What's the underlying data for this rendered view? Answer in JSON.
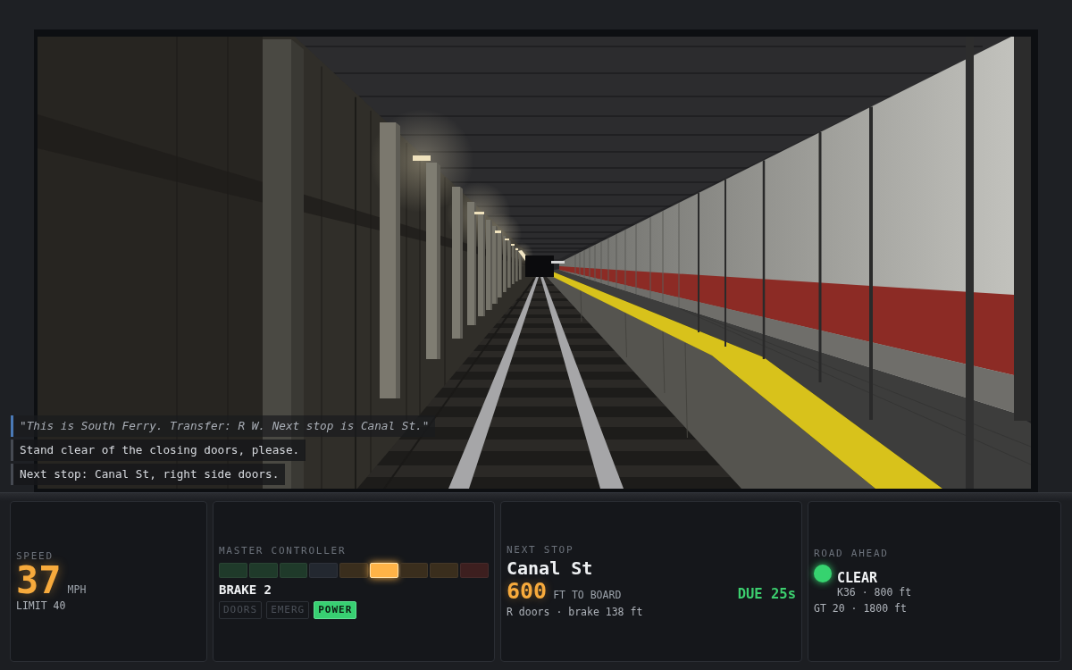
{
  "viewport": {
    "captions": [
      {
        "kind": "announcement",
        "text": "\"This is South Ferry. Transfer: R W. Next stop is Canal St.\""
      },
      {
        "kind": "message",
        "text": "Stand clear of the closing doors, please."
      },
      {
        "kind": "message",
        "text": "Next stop: Canal St, right side doors."
      }
    ]
  },
  "hud": {
    "speed": {
      "label": "SPEED",
      "value": "37",
      "unit": "MPH",
      "limit": "LIMIT 40"
    },
    "master_controller": {
      "label": "MASTER CONTROLLER",
      "notches": [
        {
          "kind": "power",
          "selected": false
        },
        {
          "kind": "power",
          "selected": false
        },
        {
          "kind": "power",
          "selected": false
        },
        {
          "kind": "coast",
          "selected": false
        },
        {
          "kind": "brake",
          "selected": false
        },
        {
          "kind": "brake",
          "selected": true
        },
        {
          "kind": "brake",
          "selected": false
        },
        {
          "kind": "brake",
          "selected": false
        },
        {
          "kind": "emergency",
          "selected": false
        }
      ],
      "position": "BRAKE 2",
      "indicators": [
        {
          "label": "DOORS",
          "on": false
        },
        {
          "label": "EMERG",
          "on": false
        },
        {
          "label": "POWER",
          "on": true
        }
      ]
    },
    "next_stop": {
      "label": "NEXT STOP",
      "station": "Canal St",
      "distance": "600",
      "distance_unit": "FT TO BOARD",
      "due": "DUE 25s",
      "detail": "R doors · brake 138 ft"
    },
    "road_ahead": {
      "label": "ROAD AHEAD",
      "signal": {
        "color": "#36d36f",
        "aspect": "CLEAR",
        "detail": "K36 · 800 ft"
      },
      "next": "GT 20 · 1800 ft"
    }
  }
}
